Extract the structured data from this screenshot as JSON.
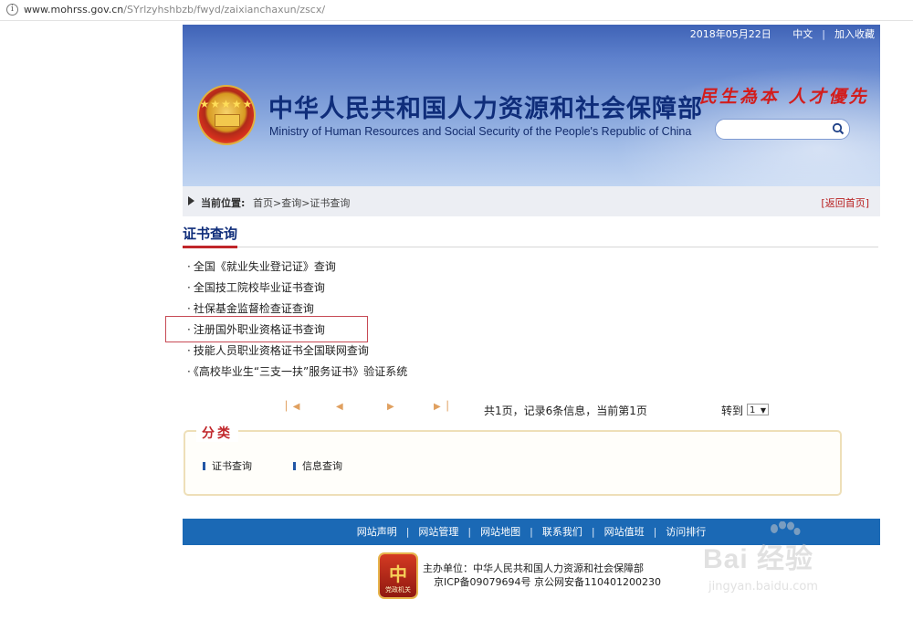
{
  "browser": {
    "url_domain": "www.mohrss.gov.cn",
    "url_path": "/SYrlzyhshbzb/fwyd/zaixianchaxun/zscx/"
  },
  "header": {
    "date": "2018年05月22日",
    "lang": "中文",
    "favorite": "加入收藏",
    "title_cn": "中华人民共和国人力资源和社会保障部",
    "title_en": "Ministry of Human Resources and Social Security of the People's Republic of China",
    "slogan": "民生為本 人才優先",
    "search_placeholder": ""
  },
  "breadcrumb": {
    "label": "当前位置:",
    "path": "首页>查询>证书查询",
    "back": "[返回首页]"
  },
  "section": {
    "title": "证书查询",
    "links": [
      "全国《就业失业登记证》查询",
      "全国技工院校毕业证书查询",
      "社保基金监督检查证查询",
      "注册国外职业资格证书查询",
      "技能人员职业资格证书全国联网查询",
      "《高校毕业生“三支一扶”服务证书》验证系统"
    ],
    "bullet": "·"
  },
  "pager": {
    "info": "共1页，记录6条信息，当前第1页",
    "goto": "转到",
    "page_value": "1"
  },
  "category": {
    "title": "分类",
    "items": [
      "证书查询",
      "信息查询"
    ]
  },
  "footer": {
    "nav": [
      "网站声明",
      "网站管理",
      "网站地图",
      "联系我们",
      "网站值班",
      "访问排行"
    ],
    "host_line": "主办单位：中华人民共和国人力资源和社会保障部",
    "icp_line": "京ICP备09079694号 京公网安备110401200230",
    "badge_caption": "党政机关"
  },
  "watermark": {
    "word": "Bai 经验",
    "sub": "jingyan.baidu.com"
  },
  "colors": {
    "brand_blue": "#0f2d7a",
    "accent_red": "#c0262a",
    "footer_blue": "#1b69b5"
  }
}
